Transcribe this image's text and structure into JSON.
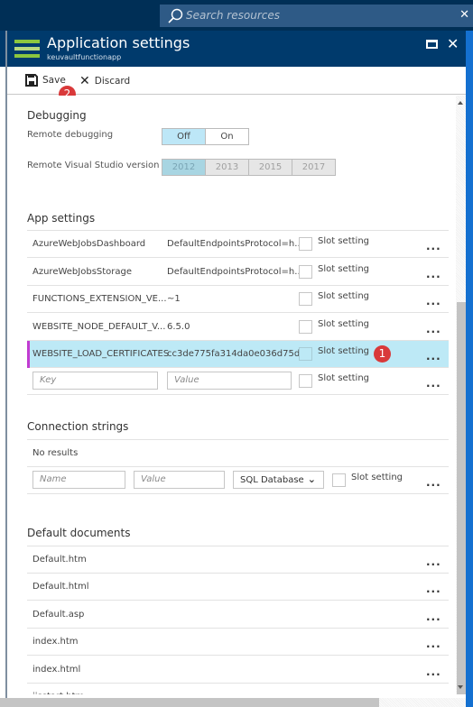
{
  "topbar": {
    "search_placeholder": "Search resources",
    "close_label": "✕"
  },
  "blade": {
    "title": "Application settings",
    "subtitle": "keuvaultfunctionapp",
    "maximize_icon": "maximize-icon",
    "close_label": "✕",
    "icon_colors": [
      "#8cc63f",
      "#b7d77f",
      "#8cc63f"
    ]
  },
  "commands": {
    "save_label": "Save",
    "discard_label": "Discard",
    "save_badge": "2"
  },
  "debugging": {
    "title": "Debugging",
    "remote_debugging_label": "Remote debugging",
    "remote_debugging_options": [
      "Off",
      "On"
    ],
    "remote_debugging_selected": "Off",
    "vs_version_label": "Remote Visual Studio version",
    "vs_version_options": [
      "2012",
      "2013",
      "2015",
      "2017"
    ],
    "vs_version_selected": "2012"
  },
  "app_settings": {
    "title": "App settings",
    "slot_label": "Slot setting",
    "more_label": "...",
    "rows": [
      {
        "key": "AzureWebJobsDashboard",
        "value": "DefaultEndpointsProtocol=h.."
      },
      {
        "key": "AzureWebJobsStorage",
        "value": "DefaultEndpointsProtocol=h.."
      },
      {
        "key": "FUNCTIONS_EXTENSION_VE...",
        "value": "~1"
      },
      {
        "key": "WEBSITE_NODE_DEFAULT_V...",
        "value": "6.5.0"
      },
      {
        "key": "WEBSITE_LOAD_CERTIFICATES",
        "value": "cc3de775fa314da0e036d75d..",
        "selected": true,
        "badge": "1"
      }
    ],
    "new_key_placeholder": "Key",
    "new_value_placeholder": "Value"
  },
  "connection_strings": {
    "title": "Connection strings",
    "empty_text": "No results",
    "name_placeholder": "Name",
    "value_placeholder": "Value",
    "type_selected": "SQL Database",
    "slot_label": "Slot setting",
    "more_label": "..."
  },
  "default_documents": {
    "title": "Default documents",
    "more_label": "...",
    "items": [
      "Default.htm",
      "Default.html",
      "Default.asp",
      "index.htm",
      "index.html",
      "iisstart.htm"
    ]
  },
  "colors": {
    "topbar": "#002f56",
    "blade_header": "#003a6c",
    "selected_row": "#bde9f6",
    "selected_accent": "#c13bd1",
    "badge": "#d9393a"
  }
}
